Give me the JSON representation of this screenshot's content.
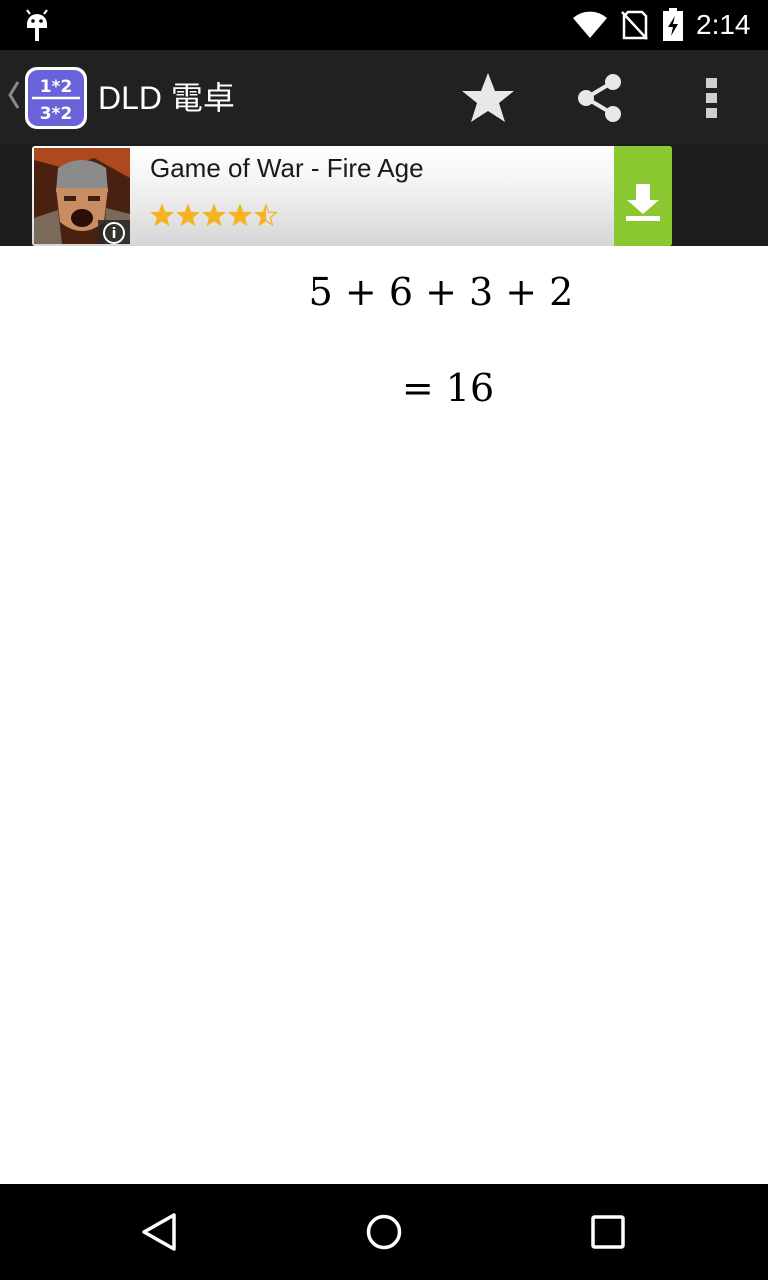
{
  "status_bar": {
    "time": "2:14",
    "icons": [
      "android-debug-icon",
      "wifi-icon",
      "no-sim-icon",
      "battery-charging-icon"
    ]
  },
  "action_bar": {
    "title": "DLD 電卓",
    "app_icon_lines": [
      "1*2",
      "3*2"
    ],
    "actions": [
      "star-icon",
      "share-icon",
      "overflow-menu-icon"
    ]
  },
  "ad": {
    "title": "Game of War - Fire Age",
    "rating": 4.5,
    "rating_max": 5,
    "info_glyph": "i",
    "colors": {
      "install_button": "#8bc82f",
      "stars": "#f5b320"
    },
    "icons": [
      "ad-info-icon",
      "download-icon"
    ]
  },
  "calculation": {
    "expression": "5 + 6 + 3 + 2",
    "result": "= 16"
  },
  "nav_bar": {
    "icons": [
      "nav-back-icon",
      "nav-home-icon",
      "nav-recents-icon"
    ]
  }
}
